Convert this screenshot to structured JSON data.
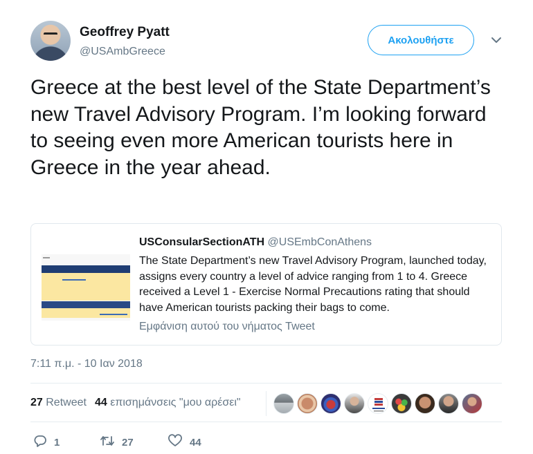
{
  "author": {
    "name": "Geoffrey Pyatt",
    "handle": "@USAmbGreece",
    "follow_label": "Ακολουθήστε"
  },
  "tweet": {
    "text": "Greece at the best level of the State Department’s new Travel Advisory Program. I’m looking forward to seeing even more American tourists here in Greece in the year ahead.",
    "timestamp": "7:11 π.μ. - 10 Ιαν 2018"
  },
  "quote": {
    "name": "USConsularSectionATH",
    "handle": "@USEmbConAthens",
    "text": "The State Department’s new Travel Advisory Program, launched today, assigns every country a level of advice ranging from 1 to 4. Greece received a Level 1 - Exercise Normal Precautions rating that should have American tourists packing their bags to come.",
    "show_thread": "Εμφάνιση αυτού του νήματος Tweet"
  },
  "stats": {
    "retweets_count": "27",
    "retweets_label": "Retweet",
    "likes_count": "44",
    "likes_label": "επισημάνσεις \"μου αρέσει\""
  },
  "actions": {
    "reply_count": "1",
    "retweet_count": "27",
    "like_count": "44"
  },
  "colors": {
    "accent": "#1da1f2",
    "secondary_text": "#657786",
    "primary_text": "#14171a"
  }
}
